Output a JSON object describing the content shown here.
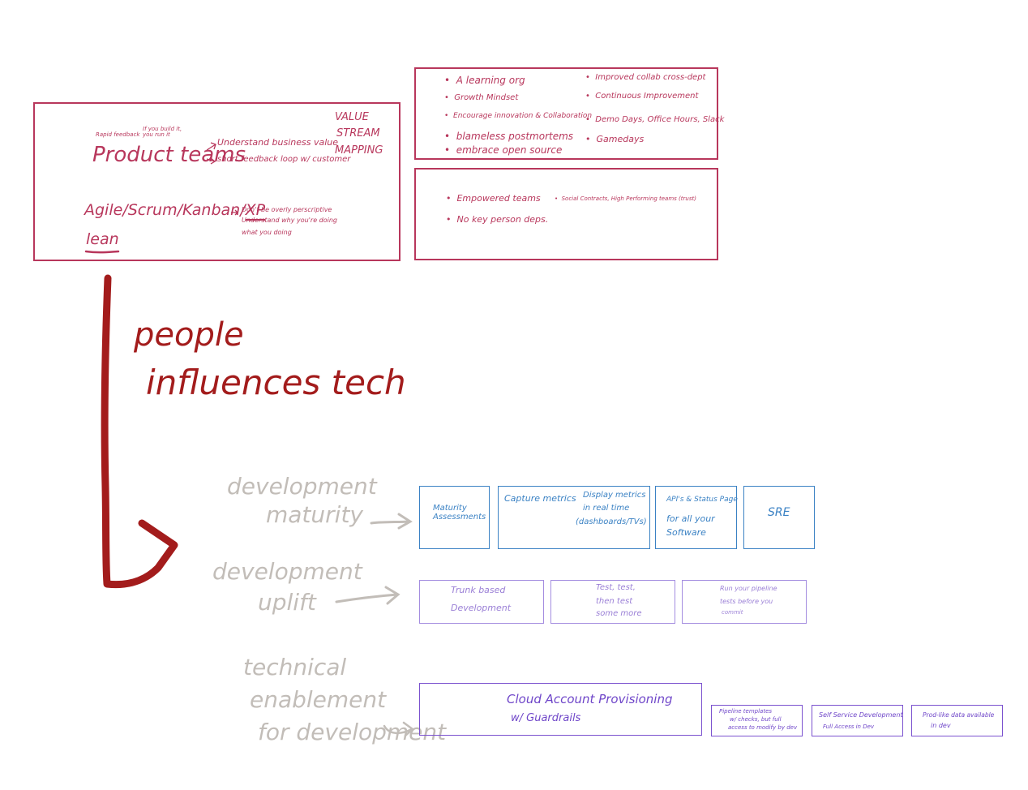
{
  "colors": {
    "pink": "#b8375c",
    "red": "#a31c1c",
    "gray": "#c2bdb8",
    "blue": "#3b82c4",
    "purple": "#9a7fd6",
    "violet": "#6f46c9"
  },
  "top_left": {
    "note_small_1": "Rapid feedback",
    "note_small_2": "If you build it, you run it",
    "product_teams": "Product teams",
    "pt_item_1": "Understand business value",
    "pt_item_2": "short feedback loop w/ customer",
    "vsm_line1": "VALUE",
    "vsm_line2": "STREAM",
    "vsm_line3": "MAPPING",
    "agile": "Agile/Scrum/Kanban/",
    "xp": "XP",
    "lean": "lean",
    "agile_note_1": "Don't be overly perscriptive",
    "agile_note_2": "Understand why you're doing",
    "agile_note_3": "what you doing"
  },
  "top_right_upper": {
    "left_items": [
      "A learning org",
      "Growth Mindset",
      "Encourage innovation & Collaboration",
      "blameless postmortems",
      "embrace open source"
    ],
    "right_items": [
      "Improved collab cross-dept",
      "Continuous Improvement",
      "Demo Days, Office Hours, Slack",
      "Gamedays"
    ]
  },
  "top_right_lower": {
    "items": [
      "Empowered teams",
      "No key person deps.",
      "Social Contracts, High Performing teams (trust)"
    ]
  },
  "arrow_label": {
    "line1": "people",
    "line2": "influences tech"
  },
  "rows": {
    "maturity": {
      "label_line1": "development",
      "label_line2": "maturity",
      "boxes": {
        "b1": "Maturity Assessments",
        "b2_left": "Capture metrics",
        "b2_right_1": "Display metrics",
        "b2_right_2": "in real time",
        "b2_right_3": "(dashboards/TVs)",
        "b3_1": "API's & Status Page",
        "b3_2": "for all your",
        "b3_3": "Software",
        "b4": "SRE"
      }
    },
    "uplift": {
      "label_line1": "development",
      "label_line2": "uplift",
      "boxes": {
        "b1_1": "Trunk based",
        "b1_2": "Development",
        "b2_1": "Test, test,",
        "b2_2": "then test",
        "b2_3": "some more",
        "b3_1": "Run your pipeline",
        "b3_2": "tests before you",
        "b3_3": "commit"
      }
    },
    "enablement": {
      "label_line1": "technical",
      "label_line2": "enablement",
      "label_line3": "for development",
      "boxes": {
        "b1_1": "Cloud Account Provisioning",
        "b1_2": "w/ Guardrails",
        "b2_1": "Pipeline templates",
        "b2_2": "w/ checks, but full",
        "b2_3": "access to modify by dev",
        "b3_1": "Self Service Development",
        "b3_2": "Full Access in Dev",
        "b4_1": "Prod-like data available",
        "b4_2": "in dev"
      }
    }
  }
}
